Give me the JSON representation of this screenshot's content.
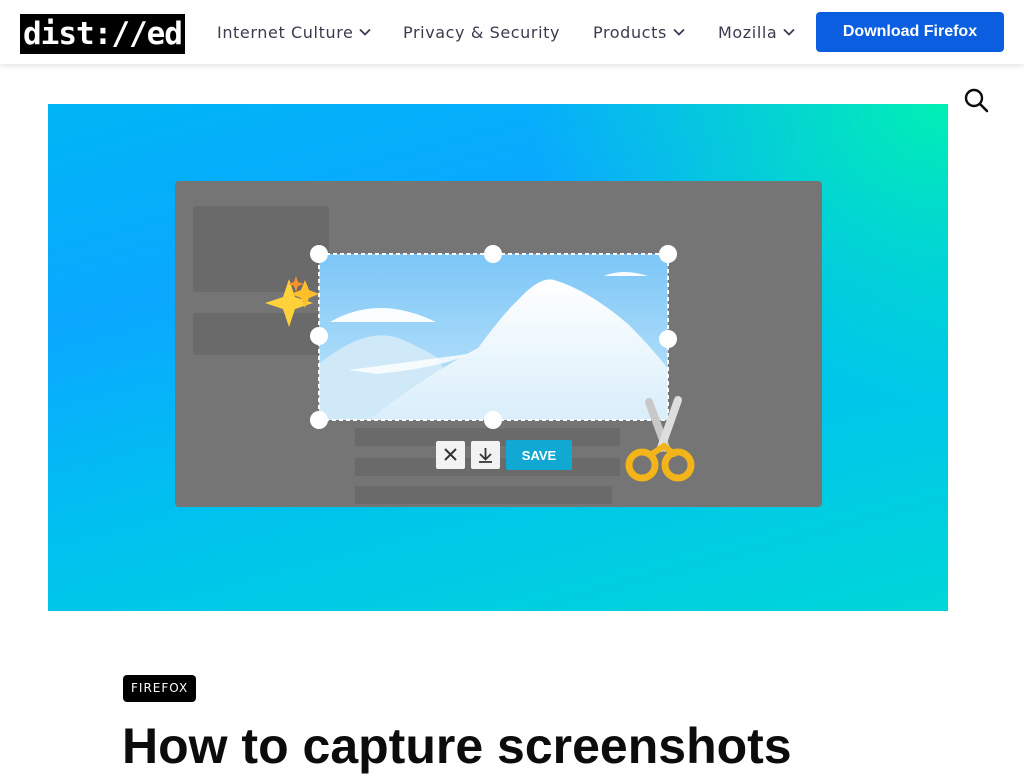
{
  "header": {
    "logo": "dist://ed",
    "nav": [
      {
        "label": "Internet Culture",
        "has_dropdown": true
      },
      {
        "label": "Privacy & Security",
        "has_dropdown": false
      },
      {
        "label": "Products",
        "has_dropdown": true
      },
      {
        "label": "Mozilla",
        "has_dropdown": true
      }
    ],
    "cta": "Download Firefox"
  },
  "hero": {
    "save_label": "SAVE"
  },
  "article": {
    "tag": "FIREFOX",
    "title": "How to capture screenshots"
  },
  "colors": {
    "accent": "#0b5ee0",
    "hero_gradient_start": "#00b5f5",
    "hero_gradient_end": "#00f0b4",
    "save_button": "#11a9d4"
  }
}
